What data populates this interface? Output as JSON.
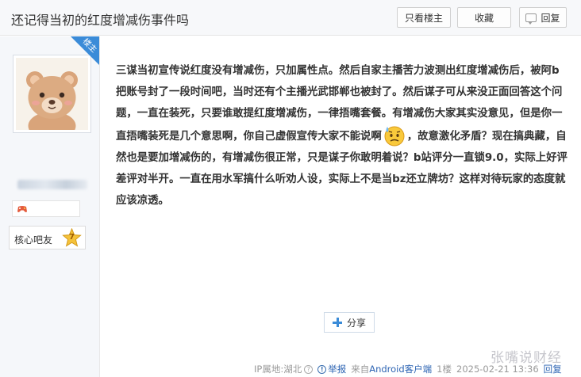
{
  "header": {
    "title": "还记得当初的红度增减伤事件吗",
    "only_author_label": "只看楼主",
    "favorite_label": "收藏",
    "reply_label": "回复"
  },
  "user": {
    "floor_badge": "楼主",
    "bar_name": "核心吧友",
    "level": "7"
  },
  "post": {
    "text_before_emoji": "三谋当初宣传说红度没有增减伤，只加属性点。然后自家主播苦力波测出红度增减伤后，被阿b把账号封了一段时间吧，当时还有个主播光武邯郸也被封了。然后谋子可从来没正面回答这个问题，一直在装死，只要谁敢提红度增减伤，一律捂嘴套餐。有增减伤大家其实没意见，但是你一直捂嘴装死是几个意思啊，你自己虚假宣传大家不能说啊",
    "text_after_emoji": "，故意激化矛盾？现在搞典藏，自然也是要加增减伤的，有增减伤很正常，只是谋子你敢明着说？b站评分一直锁9.0，实际上好评差评对半开。一直在用水军搞什么听劝人设，实际上不是当bz还立牌坊？这样对待玩家的态度就应该凉透。"
  },
  "share_label": "分享",
  "footer": {
    "ip_location": "IP属地:湖北",
    "report_label": "举报",
    "client_prefix": "来自",
    "client_name": "Android客户端",
    "floor": "1楼",
    "timestamp": "2025-02-21 13:36",
    "reply_label": "回复"
  },
  "watermark": "张嘴说财经",
  "colors": {
    "accent_blue": "#3a8bd8",
    "link_blue": "#2d64b3",
    "sidebar_bg": "#f5f7fa"
  }
}
